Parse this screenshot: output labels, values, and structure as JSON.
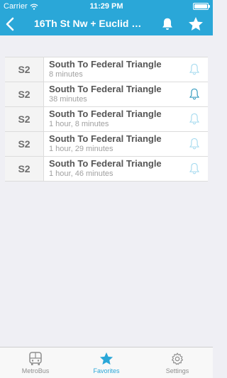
{
  "status_bar": {
    "carrier": "Carrier",
    "time": "11:29 PM",
    "battery_level": 1.0
  },
  "nav": {
    "title": "16Th St Nw + Euclid St..."
  },
  "arrivals": [
    {
      "route": "S2",
      "destination": "South To Federal Triangle",
      "eta": "8 minutes",
      "alert_active": false
    },
    {
      "route": "S2",
      "destination": "South To Federal Triangle",
      "eta": "38 minutes",
      "alert_active": true
    },
    {
      "route": "S2",
      "destination": "South To Federal Triangle",
      "eta": "1 hour, 8 minutes",
      "alert_active": false
    },
    {
      "route": "S2",
      "destination": "South To Federal Triangle",
      "eta": "1 hour, 29 minutes",
      "alert_active": false
    },
    {
      "route": "S2",
      "destination": "South To Federal Triangle",
      "eta": "1 hour, 46 minutes",
      "alert_active": false
    }
  ],
  "tabs": [
    {
      "label": "MetroBus",
      "icon": "bus-icon",
      "active": false
    },
    {
      "label": "Favorites",
      "icon": "star-icon",
      "active": true
    },
    {
      "label": "Settings",
      "icon": "gear-icon",
      "active": false
    }
  ],
  "colors": {
    "accent": "#2aa7d8",
    "background": "#efeff4",
    "bell_inactive": "#9fd8ee",
    "bell_active": "#1d8fb8"
  }
}
